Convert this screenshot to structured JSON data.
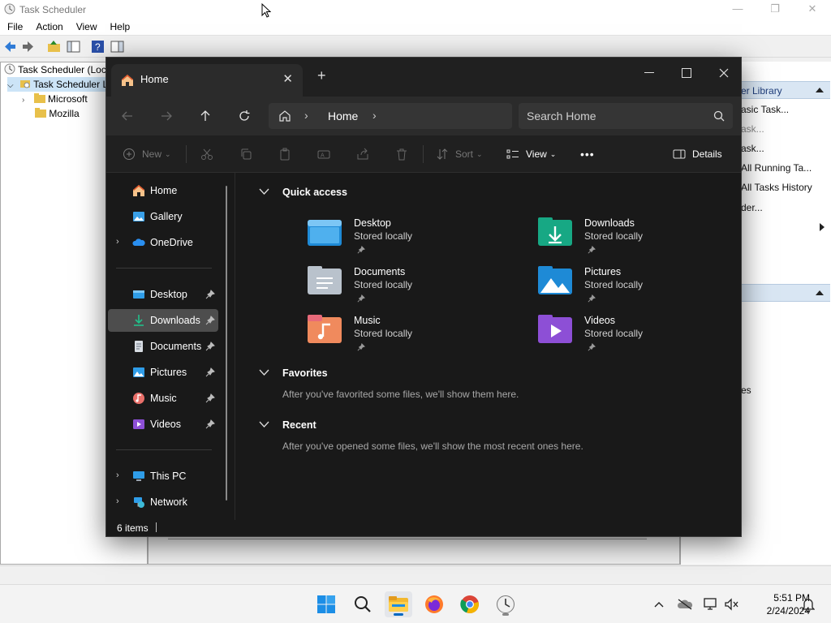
{
  "task_scheduler": {
    "title": "Task Scheduler",
    "menu": [
      "File",
      "Action",
      "View",
      "Help"
    ],
    "tree": {
      "root": "Task Scheduler (Loc",
      "library": "Task Scheduler L",
      "folders": [
        "Microsoft",
        "Mozilla"
      ]
    },
    "actions": {
      "header_1": "er Library",
      "items": [
        "asic Task...",
        "ask...",
        "ask...",
        "All Running Ta...",
        "All Tasks History",
        "der..."
      ],
      "item_es": "es"
    }
  },
  "explorer": {
    "tab_title": "Home",
    "new_tab": "+",
    "breadcrumb": [
      "Home"
    ],
    "search_placeholder": "Search Home",
    "commands": {
      "new": "New",
      "sort": "Sort",
      "view": "View",
      "more": "•••",
      "details": "Details"
    },
    "sidebar": {
      "top": [
        {
          "label": "Home",
          "icon": "home-icon"
        },
        {
          "label": "Gallery",
          "icon": "gallery-icon"
        },
        {
          "label": "OneDrive",
          "icon": "onedrive-icon"
        }
      ],
      "pinned": [
        {
          "label": "Desktop",
          "icon": "desktop-folder-icon"
        },
        {
          "label": "Downloads",
          "icon": "downloads-folder-icon"
        },
        {
          "label": "Documents",
          "icon": "documents-folder-icon"
        },
        {
          "label": "Pictures",
          "icon": "pictures-folder-icon"
        },
        {
          "label": "Music",
          "icon": "music-folder-icon"
        },
        {
          "label": "Videos",
          "icon": "videos-folder-icon"
        }
      ],
      "bottom": [
        {
          "label": "This PC",
          "icon": "this-pc-icon"
        },
        {
          "label": "Network",
          "icon": "network-icon"
        }
      ]
    },
    "sections": {
      "quick_access": "Quick access",
      "favorites": "Favorites",
      "favorites_note": "After you've favorited some files, we'll show them here.",
      "recent": "Recent",
      "recent_note": "After you've opened some files, we'll show the most recent ones here."
    },
    "quick_access": [
      {
        "name": "Desktop",
        "sub": "Stored locally"
      },
      {
        "name": "Downloads",
        "sub": "Stored locally"
      },
      {
        "name": "Documents",
        "sub": "Stored locally"
      },
      {
        "name": "Pictures",
        "sub": "Stored locally"
      },
      {
        "name": "Music",
        "sub": "Stored locally"
      },
      {
        "name": "Videos",
        "sub": "Stored locally"
      }
    ],
    "status": "6 items"
  },
  "taskbar": {
    "time": "5:51 PM",
    "date": "2/24/2024",
    "apps": [
      "start-icon",
      "search-icon",
      "file-explorer-icon",
      "firefox-icon",
      "chrome-icon",
      "task-scheduler-icon"
    ]
  }
}
